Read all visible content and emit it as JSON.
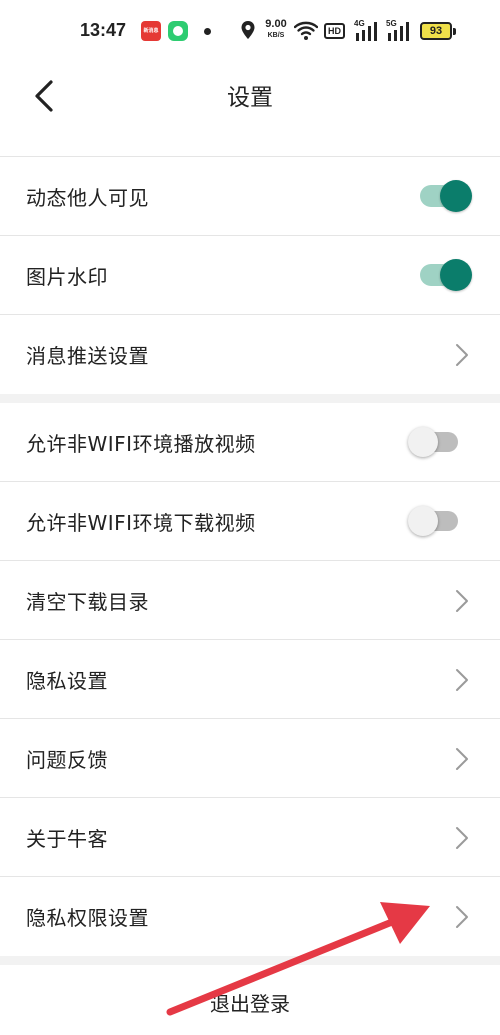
{
  "status_bar": {
    "time": "13:47",
    "notif_badge": "新消息",
    "net_speed_value": "9.00",
    "net_speed_unit": "KB/S",
    "hd_label": "HD",
    "sim1_tag": "4G",
    "sim2_tag": "5G",
    "battery": "93",
    "icons": [
      "app-notification-icon",
      "app-green-icon",
      "dot-icon",
      "location-icon",
      "wifi-icon",
      "hd-icon",
      "signal-icon",
      "signal-icon",
      "battery-icon"
    ]
  },
  "header": {
    "back_icon": "chevron-left-icon",
    "title": "设置"
  },
  "settings": {
    "group1": [
      {
        "label": "动态他人可见",
        "control": "toggle",
        "on": true
      },
      {
        "label": "图片水印",
        "control": "toggle",
        "on": true
      },
      {
        "label": "消息推送设置",
        "control": "chevron"
      }
    ],
    "group2": [
      {
        "label": "允许非WIFI环境播放视频",
        "control": "toggle",
        "on": false
      },
      {
        "label": "允许非WIFI环境下载视频",
        "control": "toggle",
        "on": false
      },
      {
        "label": "清空下载目录",
        "control": "chevron"
      },
      {
        "label": "隐私设置",
        "control": "chevron"
      },
      {
        "label": "问题反馈",
        "control": "chevron"
      },
      {
        "label": "关于牛客",
        "control": "chevron"
      },
      {
        "label": "隐私权限设置",
        "control": "chevron"
      }
    ]
  },
  "logout": {
    "label": "退出登录"
  },
  "colors": {
    "toggle_on_knob": "#0b7d6b",
    "toggle_on_track": "#9fd2c4",
    "toggle_off_track": "#bdbdbd",
    "annotation_arrow": "#e53945"
  }
}
